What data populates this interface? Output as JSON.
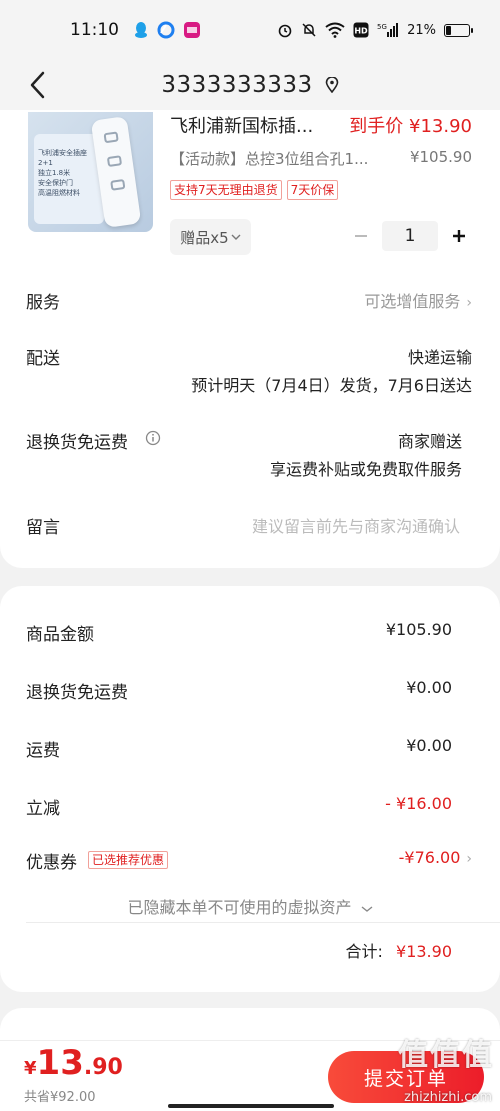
{
  "status_bar": {
    "time": "11:10",
    "network": "5G",
    "battery": "21%",
    "battery_level": 0.21
  },
  "header": {
    "title": "3333333333"
  },
  "product": {
    "name": "飞利浦新国标插...",
    "deal_price": "到手价 ¥13.90",
    "spec": "【活动款】总控3位组合孔1...",
    "original_price": "¥105.90",
    "tags": [
      "支持7天无理由退货",
      "7天价保"
    ],
    "gift_label": "赠品x5",
    "quantity": "1",
    "image_caption": [
      "飞利浦安全插座",
      "2+1",
      "独立1.8米",
      "安全保护门",
      "高温阻燃材料"
    ]
  },
  "order_options": {
    "service": {
      "label": "服务",
      "value": "可选增值服务"
    },
    "delivery": {
      "label": "配送",
      "value": "快递运输",
      "detail": "预计明天（7月4日）发货，7月6日送达"
    },
    "return_shipping": {
      "label": "退换货免运费",
      "value": "商家赠送",
      "detail": "享运费补贴或免费取件服务"
    },
    "message": {
      "label": "留言",
      "placeholder": "建议留言前先与商家沟通确认"
    }
  },
  "summary": {
    "items_total": {
      "label": "商品金额",
      "value": "¥105.90"
    },
    "return_fee": {
      "label": "退换货免运费",
      "value": "¥0.00"
    },
    "shipping": {
      "label": "运费",
      "value": "¥0.00"
    },
    "instant_discount": {
      "label": "立减",
      "value": "- ¥16.00"
    },
    "coupon": {
      "label": "优惠券",
      "tag": "已选推荐优惠",
      "value": "-¥76.00"
    },
    "hidden_assets": "已隐藏本单不可使用的虚拟资产",
    "total_label": "合计:",
    "total_value": "¥13.90"
  },
  "bottom_bar": {
    "currency": "¥",
    "price_int": "13",
    "price_dec": ".90",
    "saved": "共省¥92.00",
    "submit_label": "提交订单"
  },
  "watermark": {
    "text": "值值值",
    "site": "zhizhizhi.com"
  },
  "colors": {
    "accent_red": "#e02020",
    "background": "#f2f2f2",
    "card": "#ffffff"
  }
}
